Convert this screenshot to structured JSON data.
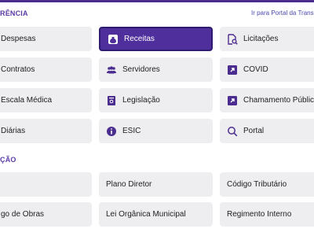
{
  "section1": {
    "title": "RÊNCIA",
    "portal_link": "Ir para Portal da Transp"
  },
  "grid1": [
    {
      "label": "Despesas",
      "icon": "none",
      "active": false
    },
    {
      "label": "Receitas",
      "icon": "money-bag-icon",
      "active": true
    },
    {
      "label": "Licitações",
      "icon": "document-search-icon",
      "active": false
    },
    {
      "label": "Contratos",
      "icon": "none",
      "active": false
    },
    {
      "label": "Servidores",
      "icon": "users-icon",
      "active": false
    },
    {
      "label": "COVID",
      "icon": "external-link-icon",
      "active": false
    },
    {
      "label": "Escala Médica",
      "icon": "none",
      "active": false
    },
    {
      "label": "Legislação",
      "icon": "book-icon",
      "active": false
    },
    {
      "label": "Chamamento Público",
      "icon": "external-link-icon",
      "active": false
    },
    {
      "label": "Diárias",
      "icon": "none",
      "active": false
    },
    {
      "label": "ESIC",
      "icon": "info-icon",
      "active": false
    },
    {
      "label": "Portal",
      "icon": "search-icon",
      "active": false
    }
  ],
  "section2": {
    "title": "ÇÃO"
  },
  "grid2": [
    {
      "label": ""
    },
    {
      "label": "Plano Diretor"
    },
    {
      "label": "Código Tributário"
    },
    {
      "label": "go de Obras"
    },
    {
      "label": "Lei Orgânica Municipal"
    },
    {
      "label": "Regimento Interno"
    }
  ],
  "colors": {
    "accent": "#4f2f9c",
    "button_bg": "#eeeef0",
    "section_title": "#5b3aa6",
    "icon": "#4b2c8f"
  }
}
